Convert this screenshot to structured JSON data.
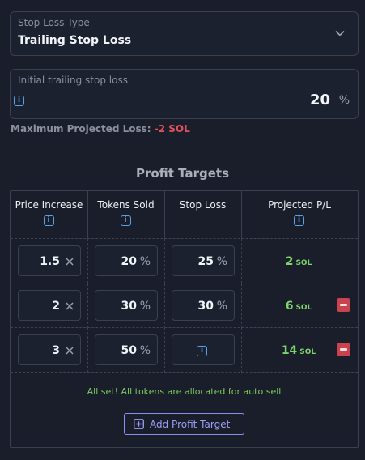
{
  "stop_loss_type": {
    "label": "Stop Loss Type",
    "value": "Trailing Stop Loss"
  },
  "trailing_stop": {
    "label": "Initial trailing stop loss",
    "value": "20",
    "unit": "%"
  },
  "max_loss": {
    "label": "Maximum Projected Loss:",
    "value": "-2 SOL"
  },
  "profit_targets": {
    "title": "Profit Targets",
    "columns": [
      "Price Increase",
      "Tokens Sold",
      "Stop Loss",
      "Projected P/L"
    ],
    "rows": [
      {
        "price_increase": "1.5",
        "tokens_sold": "20",
        "stop_loss": "25",
        "pl_value": "2",
        "pl_unit": "SOL"
      },
      {
        "price_increase": "2",
        "tokens_sold": "30",
        "stop_loss": "30",
        "pl_value": "6",
        "pl_unit": "SOL"
      },
      {
        "price_increase": "3",
        "tokens_sold": "50",
        "stop_loss": "",
        "pl_value": "14",
        "pl_unit": "SOL"
      }
    ],
    "percent_sign": "%",
    "status_message": "All set! All tokens are allocated for auto sell",
    "add_button_label": "Add Profit Target"
  },
  "icons": {
    "info": "info-icon",
    "chevron": "chevron-down-icon",
    "clear": "close-icon",
    "remove": "minus-icon",
    "add": "plus-square-icon"
  },
  "colors": {
    "background": "#1a1e2b",
    "negative": "#e0525c",
    "positive": "#7ed46a",
    "accent": "#8c8ff0",
    "info": "#5aa0e0",
    "remove": "#c8434d"
  }
}
